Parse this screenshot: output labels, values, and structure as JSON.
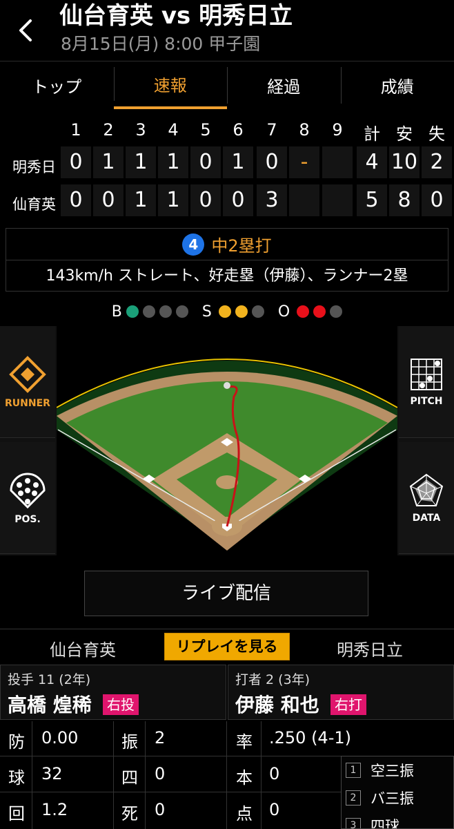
{
  "header": {
    "title": "仙台育英 vs 明秀日立",
    "subtitle": "8月15日(月) 8:00 甲子園"
  },
  "tabs": [
    {
      "label": "トップ"
    },
    {
      "label": "速報"
    },
    {
      "label": "経過"
    },
    {
      "label": "成績"
    }
  ],
  "scoreboard": {
    "innings": [
      "1",
      "2",
      "3",
      "4",
      "5",
      "6",
      "7",
      "8",
      "9"
    ],
    "totals_headers": [
      "計",
      "安",
      "失"
    ],
    "teams": [
      {
        "name": "明秀日",
        "innings": [
          "0",
          "1",
          "1",
          "1",
          "0",
          "1",
          "0",
          "-",
          ""
        ],
        "totals": [
          "4",
          "10",
          "2"
        ]
      },
      {
        "name": "仙育英",
        "innings": [
          "0",
          "0",
          "1",
          "1",
          "0",
          "0",
          "3",
          "",
          ""
        ],
        "totals": [
          "5",
          "8",
          "0"
        ]
      }
    ]
  },
  "play": {
    "batter_number": "4",
    "result": "中2塁打",
    "description": "143km/h ストレート、好走塁（伊藤）、ランナー2塁"
  },
  "count": {
    "b_label": "B",
    "s_label": "S",
    "o_label": "O",
    "balls": 1,
    "strikes": 2,
    "outs": 2
  },
  "side_buttons": {
    "runner": "RUNNER",
    "pitch": "PITCH",
    "pos": "POS.",
    "data": "DATA"
  },
  "colors": {
    "accent": "#f0a030",
    "ball": "#1aa079",
    "strike": "#f2b31e",
    "out": "#e8101a",
    "hand_badge": "#e0156d"
  },
  "live_button": "ライブ配信",
  "team_row": {
    "home": "仙台育英",
    "replay": "リプレイを見る",
    "away": "明秀日立"
  },
  "pitcher": {
    "role": "投手 11 (2年)",
    "name": "高橋 煌稀",
    "hand": "右投",
    "stats": [
      {
        "label": "防",
        "value": "0.00"
      },
      {
        "label": "振",
        "value": "2"
      },
      {
        "label": "球",
        "value": "32"
      },
      {
        "label": "四",
        "value": "0"
      },
      {
        "label": "回",
        "value": "1.2"
      },
      {
        "label": "死",
        "value": "0"
      }
    ]
  },
  "batter": {
    "role": "打者 2 (3年)",
    "name": "伊藤 和也",
    "hand": "右打",
    "stats": [
      {
        "label": "率",
        "value": ".250 (4-1)"
      },
      {
        "label": "本",
        "value": "0"
      },
      {
        "label": "点",
        "value": "0"
      }
    ],
    "results": [
      {
        "num": "1",
        "text": "空三振"
      },
      {
        "num": "2",
        "text": "バ三振"
      },
      {
        "num": "3",
        "text": "四球"
      }
    ]
  }
}
